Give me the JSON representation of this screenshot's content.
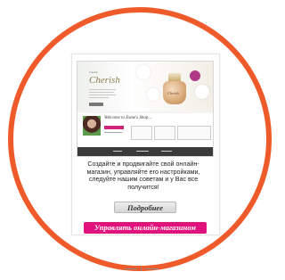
{
  "preview": {
    "banner_tag": "Cherish",
    "banner_brand": "Cherish",
    "bottle_label": "Cherish",
    "welcome_text": "Welcome to Esme's Shop..."
  },
  "promo": {
    "description": "Создайте и продвигайте свой онлайн-магазин, управляйте его настройками, следуйте нашим советам и у Вас все получится!",
    "more_label": "Подробнее",
    "manage_label": "Управлять онлайн-магазином"
  },
  "colors": {
    "ring": "#ef5a2a",
    "manage_button": "#e0137d"
  }
}
